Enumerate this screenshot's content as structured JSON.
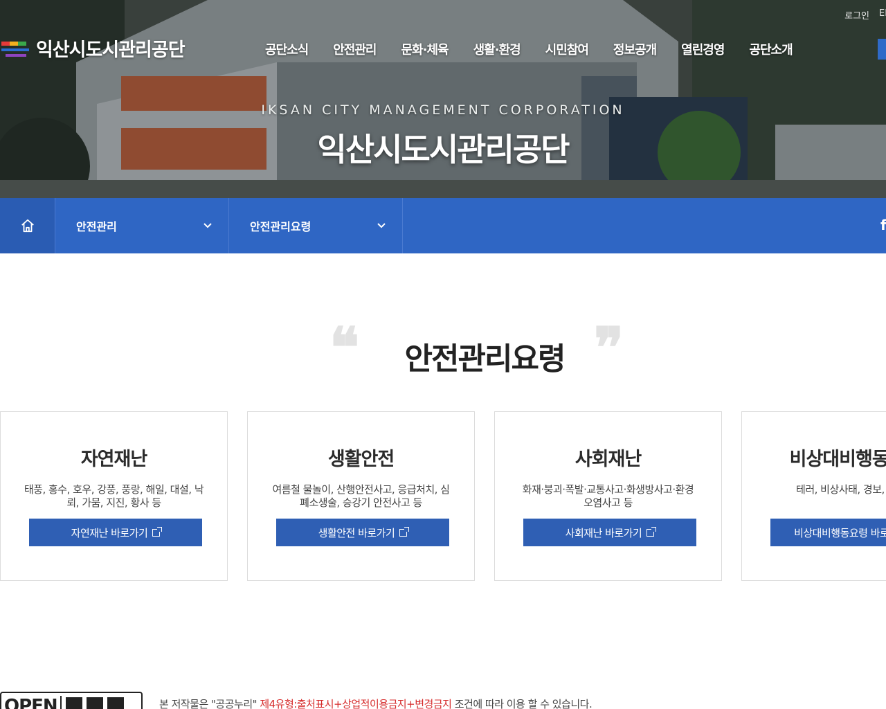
{
  "header": {
    "util_links": [
      "로그인",
      "ENG"
    ],
    "logo_text": "익산시도시관리공단",
    "nav": [
      "공단소식",
      "안전관리",
      "문화·체육",
      "생활·환경",
      "시민참여",
      "정보공개",
      "열린경영",
      "공단소개"
    ],
    "hero_subtitle": "IKSAN CITY MANAGEMENT CORPORATION",
    "hero_title": "익산시도시관리공단"
  },
  "location": {
    "depth1": "안전관리",
    "depth2": "안전관리요령"
  },
  "page_title": "안전관리요령",
  "cards": [
    {
      "title": "자연재난",
      "desc": "태풍, 홍수, 호우, 강풍, 풍랑, 해일, 대설, 낙뢰, 가뭄, 지진, 황사 등",
      "button": "자연재난 바로가기"
    },
    {
      "title": "생활안전",
      "desc": "여름철 물놀이, 산행안전사고, 응급처치, 심폐소생술, 승강기 안전사고 등",
      "button": "생활안전 바로가기"
    },
    {
      "title": "사회재난",
      "desc": "화재·붕괴·폭발·교통사고·화생방사고·환경오염사고 등",
      "button": "사회재난 바로가기"
    },
    {
      "title": "비상대비행동요령",
      "desc": "테러, 비상사태, 경보, 화생방",
      "button": "비상대비행동요령 바로가기"
    }
  ],
  "license": {
    "badge": "OPEN",
    "text_before": "본 저작물은 \"공공누리\" ",
    "text_highlight": "제4유형:출처표시+상업적이용금지+변경금지",
    "text_after": " 조건에 따라 이용 할 수 있습니다."
  },
  "colors": {
    "primary_blue": "#2f66c4",
    "button_blue": "#2f5fb4",
    "license_red": "#d62b2b"
  }
}
